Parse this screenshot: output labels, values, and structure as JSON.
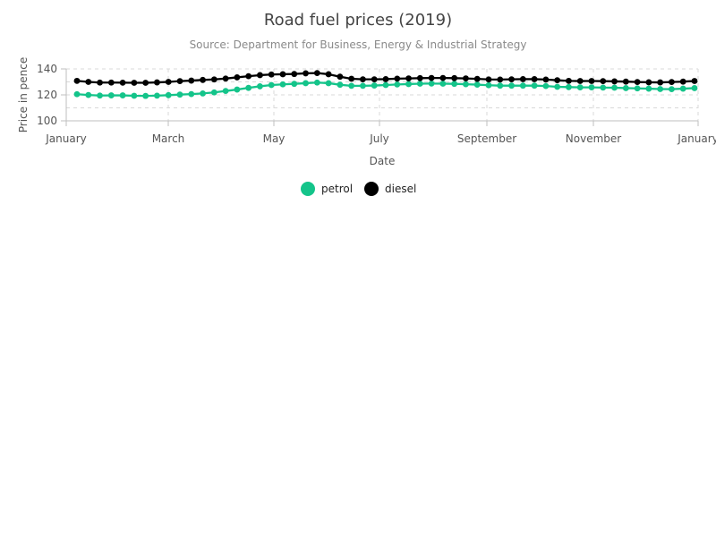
{
  "chart_data": {
    "type": "line",
    "title": "Road fuel prices (2019)",
    "subtitle": "Source: Department for Business, Energy & Industrial Strategy",
    "xlabel": "Date",
    "ylabel": "Price in pence",
    "x_tick_labels": [
      "January",
      "March",
      "May",
      "July",
      "September",
      "November",
      "January"
    ],
    "y_tick_labels": [
      "100",
      "120",
      "140"
    ],
    "xlim": [
      "2019-01-01",
      "2020-01-01"
    ],
    "ylim": [
      100,
      140
    ],
    "grid": true,
    "legend_position": "bottom-center",
    "series": [
      {
        "name": "petrol",
        "color": "#14c48a",
        "values": [
          120.5,
          119.9,
          119.5,
          119.6,
          119.6,
          119.3,
          119.2,
          119.4,
          119.8,
          120.2,
          120.6,
          121.1,
          121.9,
          123.0,
          124.1,
          125.4,
          126.6,
          127.6,
          128.1,
          128.5,
          129.0,
          129.5,
          129.0,
          127.8,
          127.0,
          127.0,
          127.2,
          127.6,
          128.0,
          128.3,
          128.6,
          128.7,
          128.6,
          128.5,
          128.2,
          127.9,
          127.4,
          127.1,
          127.1,
          127.1,
          127.1,
          126.8,
          126.2,
          126.0,
          125.8,
          125.8,
          125.6,
          125.5,
          125.2,
          125.0,
          124.8,
          124.5,
          124.4,
          124.8,
          125.2
        ]
      },
      {
        "name": "diesel",
        "color": "#000000",
        "values": [
          130.8,
          130.0,
          129.5,
          129.5,
          129.4,
          129.3,
          129.3,
          129.6,
          130.0,
          130.6,
          131.0,
          131.5,
          131.9,
          132.6,
          133.5,
          134.4,
          135.2,
          135.7,
          135.9,
          136.1,
          136.6,
          136.8,
          135.9,
          134.0,
          132.4,
          132.0,
          132.0,
          132.1,
          132.5,
          132.7,
          132.9,
          133.0,
          133.0,
          132.9,
          132.7,
          132.3,
          131.9,
          131.8,
          132.0,
          132.1,
          132.1,
          131.8,
          131.3,
          130.8,
          130.7,
          130.7,
          130.6,
          130.4,
          130.2,
          129.9,
          129.7,
          129.6,
          129.9,
          130.2,
          130.7
        ]
      }
    ]
  }
}
